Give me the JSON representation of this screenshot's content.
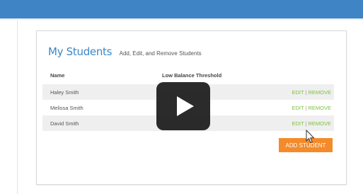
{
  "header": {
    "bar_color": "#3f85c6"
  },
  "panel": {
    "title": "My Students",
    "subtitle": "Add, Edit, and Remove Students",
    "columns": {
      "name": "Name",
      "threshold": "Low Balance Threshold"
    },
    "students": [
      {
        "name": "Haley Smith",
        "edit": "EDIT",
        "separator": "|",
        "remove": "REMOVE"
      },
      {
        "name": "Melissa Smith",
        "edit": "EDIT",
        "separator": "|",
        "remove": "REMOVE"
      },
      {
        "name": "David Smith",
        "edit": "EDIT",
        "separator": "|",
        "remove": "REMOVE"
      }
    ],
    "add_button": "ADD STUDENT"
  },
  "video_overlay": {
    "icon": "play-icon"
  },
  "colors": {
    "accent": "#3a87c8",
    "action_link": "#7fbf3f",
    "add_button": "#f48b2a"
  }
}
